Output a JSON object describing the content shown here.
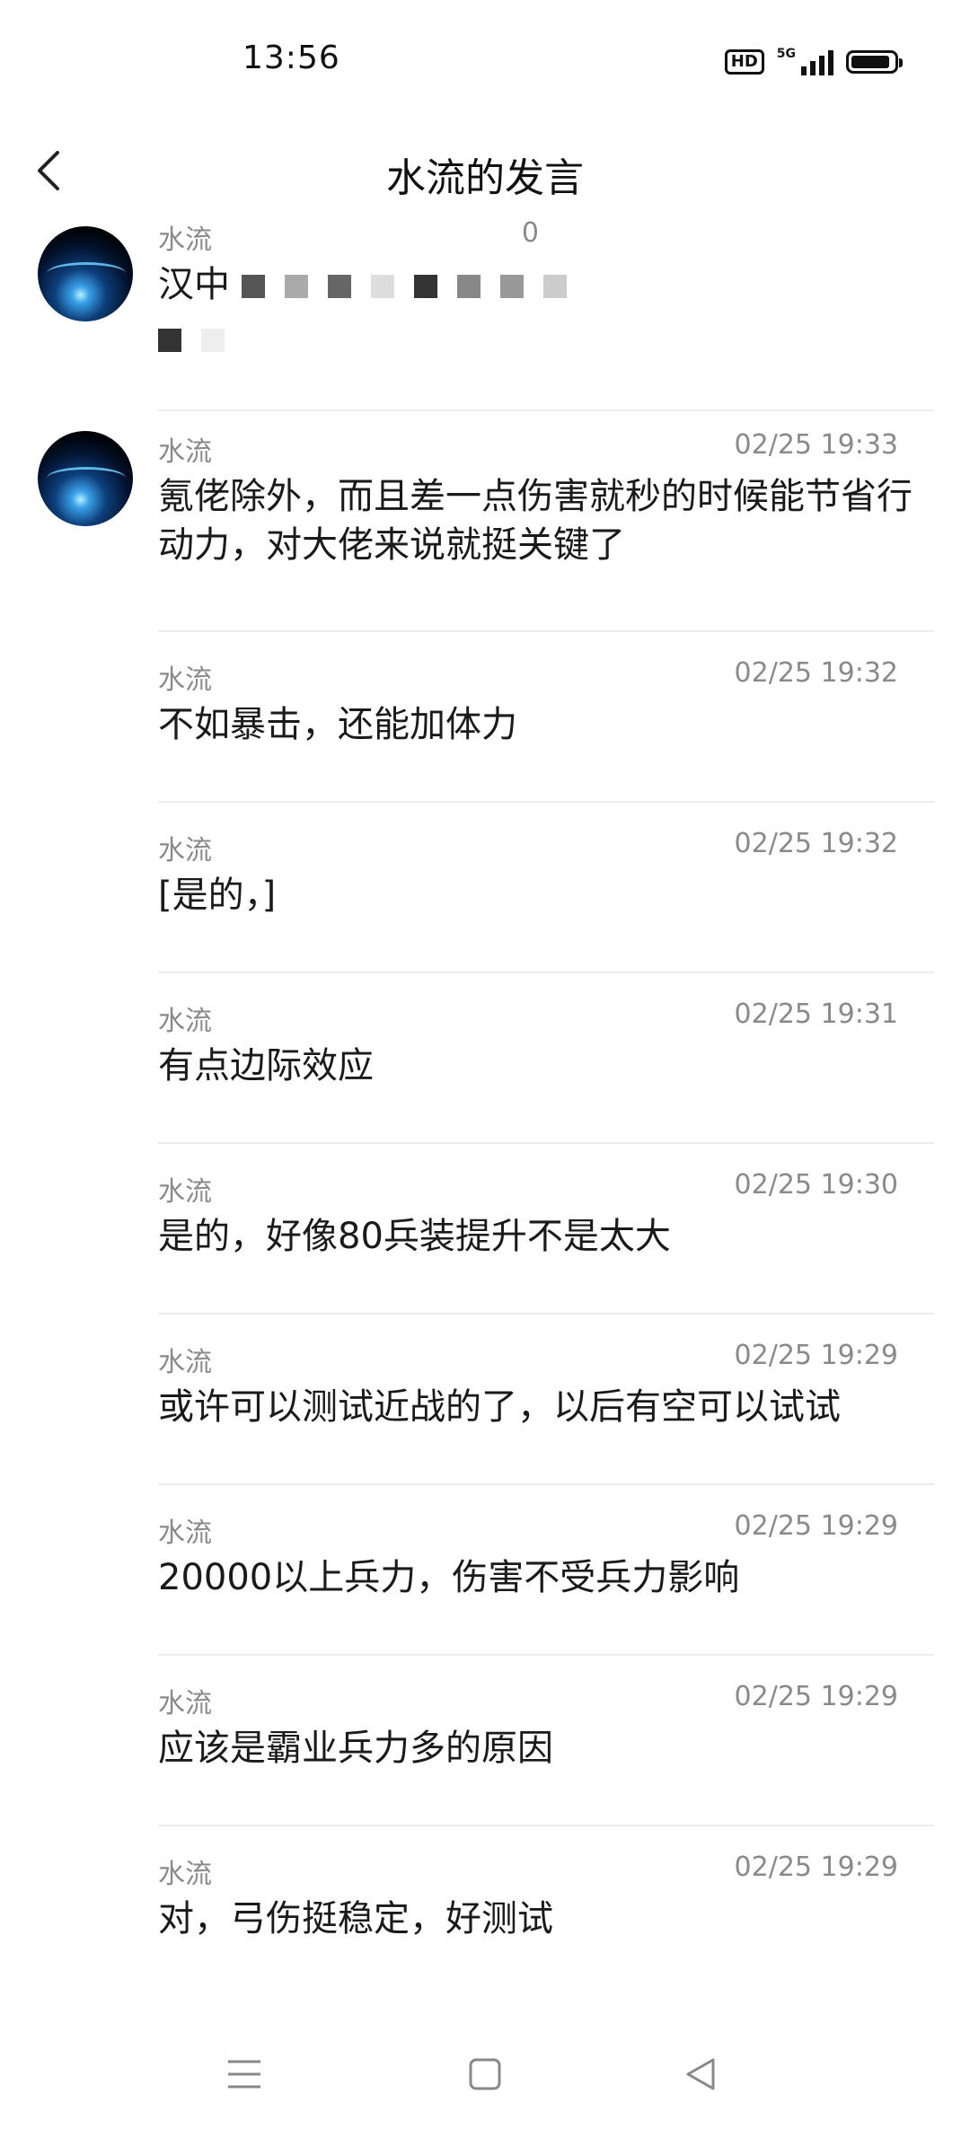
{
  "status_bar": {
    "time": "13:56",
    "hd_label": "HD",
    "network": "5G"
  },
  "header": {
    "title": "水流的发言",
    "back_icon": "back-chevron-icon"
  },
  "posts": [
    {
      "author": "水流",
      "time": "0",
      "content": "汉中",
      "content_line2": ""
    },
    {
      "author": "水流",
      "time": "02/25 19:33",
      "content": "氪佬除外，而且差一点伤害就秒的时候能节省行动力，对大佬来说就挺关键了"
    },
    {
      "author": "水流",
      "time": "02/25 19:32",
      "content": "不如暴击，还能加体力"
    },
    {
      "author": "水流",
      "time": "02/25 19:32",
      "content": "[是的，]"
    },
    {
      "author": "水流",
      "time": "02/25 19:31",
      "content": "有点边际效应"
    },
    {
      "author": "水流",
      "time": "02/25 19:30",
      "content": "是的，好像80兵装提升不是太大"
    },
    {
      "author": "水流",
      "time": "02/25 19:29",
      "content": "或许可以测试近战的了，以后有空可以试试"
    },
    {
      "author": "水流",
      "time": "02/25 19:29",
      "content": "20000以上兵力，伤害不受兵力影响"
    },
    {
      "author": "水流",
      "time": "02/25 19:29",
      "content": "应该是霸业兵力多的原因"
    },
    {
      "author": "水流",
      "time": "02/25 19:29",
      "content": "对，弓伤挺稳定，好测试"
    }
  ],
  "nav_bar": {
    "menu_icon": "menu-icon",
    "home_icon": "home-square-icon",
    "back_icon": "back-triangle-icon"
  }
}
